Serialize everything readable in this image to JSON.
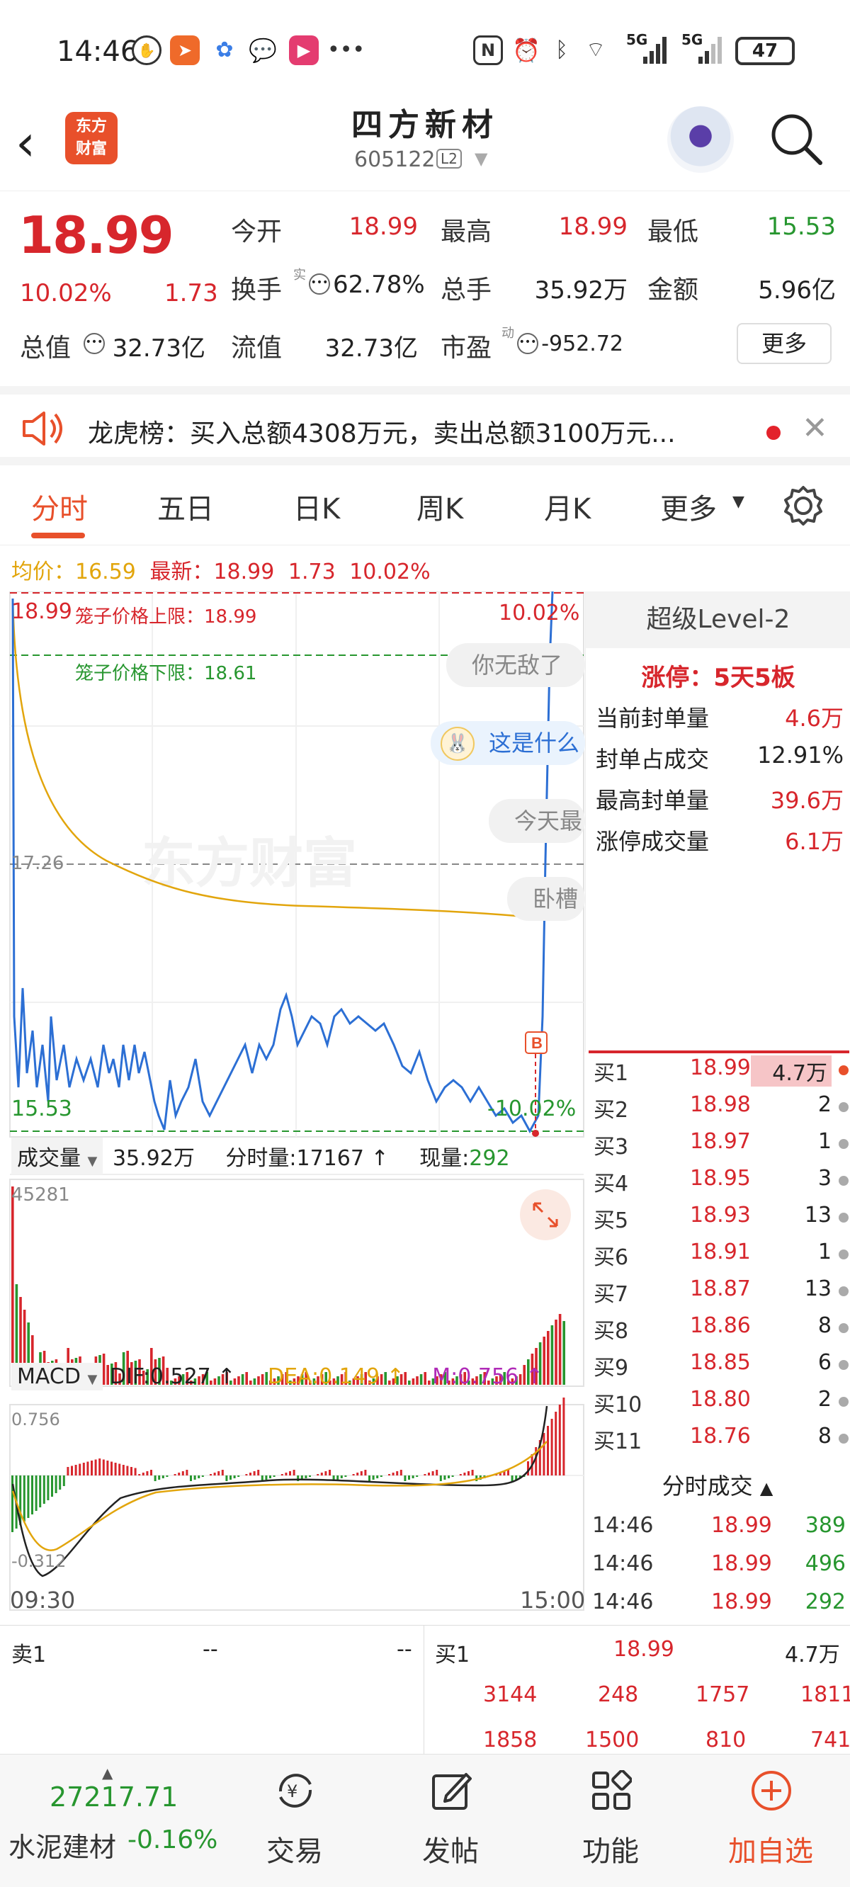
{
  "status_bar": {
    "time": "14:46",
    "battery": "47",
    "signal_1": "5G",
    "signal_2": "5G"
  },
  "header": {
    "stock_name": "四方新材",
    "stock_code": "605122",
    "level_badge": "L2",
    "logo_text_1": "东方",
    "logo_text_2": "财富"
  },
  "quote": {
    "last_price": "18.99",
    "change_pct": "10.02%",
    "change_amt": "1.73",
    "open_label": "今开",
    "open": "18.99",
    "high_label": "最高",
    "high": "18.99",
    "low_label": "最低",
    "low": "15.53",
    "turnover_label": "换手",
    "turnover_sup": "实",
    "turnover": "62.78%",
    "volume_label": "总手",
    "volume": "35.92万",
    "amount_label": "金额",
    "amount": "5.96亿",
    "mcap_label": "总值",
    "mcap": "32.73亿",
    "float_label": "流值",
    "float_cap": "32.73亿",
    "pe_label": "市盈",
    "pe_sup": "动",
    "pe": "-952.72",
    "more": "更多"
  },
  "news": {
    "text": "龙虎榜：买入总额4308万元，卖出总额3100万元..."
  },
  "tabs": [
    "分时",
    "五日",
    "日K",
    "周K",
    "月K",
    "更多"
  ],
  "avg_line": {
    "avg_label": "均价：",
    "avg": "16.59",
    "latest_label": "最新：",
    "latest": "18.99",
    "chg": "1.73",
    "pct": "10.02%"
  },
  "chart": {
    "top_price": "18.99",
    "upper_cage": "笼子价格上限：18.99",
    "top_pct": "10.02%",
    "lower_cage": "笼子价格下限：18.61",
    "mid_price": "17.26",
    "low_price": "15.53",
    "low_pct": "-10.02%",
    "buy_marker": "B",
    "watermark": "东方财富",
    "bubbles": [
      "你无敌了",
      "这是什么",
      "今天最",
      "卧槽"
    ]
  },
  "volume_bar": {
    "label": "成交量",
    "total": "35.92万",
    "tick_label": "分时量:",
    "tick_value": "17167",
    "now_label": "现量:",
    "now_value": "292",
    "max": "45281"
  },
  "macd": {
    "label": "MACD",
    "dif": "DIF:0.527",
    "dea": "DEA:0.149",
    "m": "M:0.756",
    "top": "0.756",
    "bottom": "-0.312",
    "t_start": "09:30",
    "t_end": "15:00"
  },
  "level2": {
    "title": "超级Level-2",
    "limit_up": "涨停：5天5板",
    "rows": [
      {
        "label": "当前封单量",
        "value": "4.6万"
      },
      {
        "label": "封单占成交",
        "value": "12.91%"
      },
      {
        "label": "最高封单量",
        "value": "39.6万"
      },
      {
        "label": "涨停成交量",
        "value": "6.1万"
      }
    ]
  },
  "bids": [
    {
      "label": "买1",
      "price": "18.99",
      "qty": "4.7万"
    },
    {
      "label": "买2",
      "price": "18.98",
      "qty": "2"
    },
    {
      "label": "买3",
      "price": "18.97",
      "qty": "1"
    },
    {
      "label": "买4",
      "price": "18.95",
      "qty": "3"
    },
    {
      "label": "买5",
      "price": "18.93",
      "qty": "13"
    },
    {
      "label": "买6",
      "price": "18.91",
      "qty": "1"
    },
    {
      "label": "买7",
      "price": "18.87",
      "qty": "13"
    },
    {
      "label": "买8",
      "price": "18.86",
      "qty": "8"
    },
    {
      "label": "买9",
      "price": "18.85",
      "qty": "6"
    },
    {
      "label": "买10",
      "price": "18.80",
      "qty": "2"
    },
    {
      "label": "买11",
      "price": "18.76",
      "qty": "8"
    }
  ],
  "ticks": {
    "title": "分时成交",
    "rows": [
      {
        "time": "14:46",
        "price": "18.99",
        "qty": "389"
      },
      {
        "time": "14:46",
        "price": "18.99",
        "qty": "496"
      },
      {
        "time": "14:46",
        "price": "18.99",
        "qty": "292"
      }
    ]
  },
  "orderbook": {
    "sell_label": "卖1",
    "sell_price": "--",
    "sell_qty": "--",
    "buy_label": "买1",
    "buy_price": "18.99",
    "buy_qty": "4.7万",
    "row2": [
      "3144",
      "248",
      "1757",
      "1811"
    ],
    "row3": [
      "1858",
      "1500",
      "810",
      "741"
    ]
  },
  "bottom_nav": {
    "index_value": "27217.71",
    "index_name": "水泥建材",
    "index_chg": "-0.16%",
    "trade": "交易",
    "post": "发帖",
    "functions": "功能",
    "add_watch": "加自选"
  },
  "colors": {
    "up": "#d7262c",
    "down": "#27962f",
    "accent": "#e8502b",
    "price_line": "#2c6fd4",
    "avg_line": "#e2a50c"
  }
}
